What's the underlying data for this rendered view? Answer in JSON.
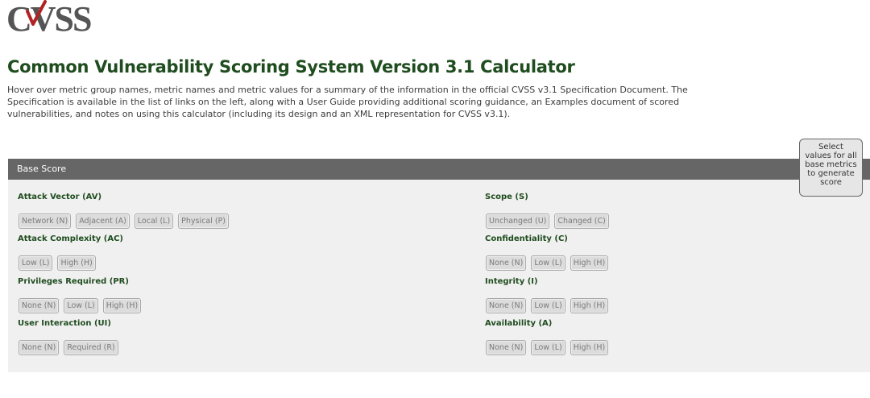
{
  "logo": {
    "text": "CVSS",
    "accent_color": "#b22222"
  },
  "page": {
    "title": "Common Vulnerability Scoring System Version 3.1 Calculator",
    "intro": "Hover over metric group names, metric names and metric values for a summary of the information in the official CVSS v3.1 Specification Document. The Specification is available in the list of links on the left, along with a User Guide providing additional scoring guidance, an Examples document of scored vulnerabilities, and notes on using this calculator (including its design and an XML representation for CVSS v3.1)."
  },
  "base_score": {
    "header": "Base Score",
    "score_hint": "Select values for all base metrics to generate score",
    "left_metrics": [
      {
        "name": "Attack Vector (AV)",
        "values": [
          "Network (N)",
          "Adjacent (A)",
          "Local (L)",
          "Physical (P)"
        ]
      },
      {
        "name": "Attack Complexity (AC)",
        "values": [
          "Low (L)",
          "High (H)"
        ]
      },
      {
        "name": "Privileges Required (PR)",
        "values": [
          "None (N)",
          "Low (L)",
          "High (H)"
        ]
      },
      {
        "name": "User Interaction (UI)",
        "values": [
          "None (N)",
          "Required (R)"
        ]
      }
    ],
    "right_metrics": [
      {
        "name": "Scope (S)",
        "values": [
          "Unchanged (U)",
          "Changed (C)"
        ]
      },
      {
        "name": "Confidentiality (C)",
        "values": [
          "None (N)",
          "Low (L)",
          "High (H)"
        ]
      },
      {
        "name": "Integrity (I)",
        "values": [
          "None (N)",
          "Low (L)",
          "High (H)"
        ]
      },
      {
        "name": "Availability (A)",
        "values": [
          "None (N)",
          "Low (L)",
          "High (H)"
        ]
      }
    ]
  }
}
